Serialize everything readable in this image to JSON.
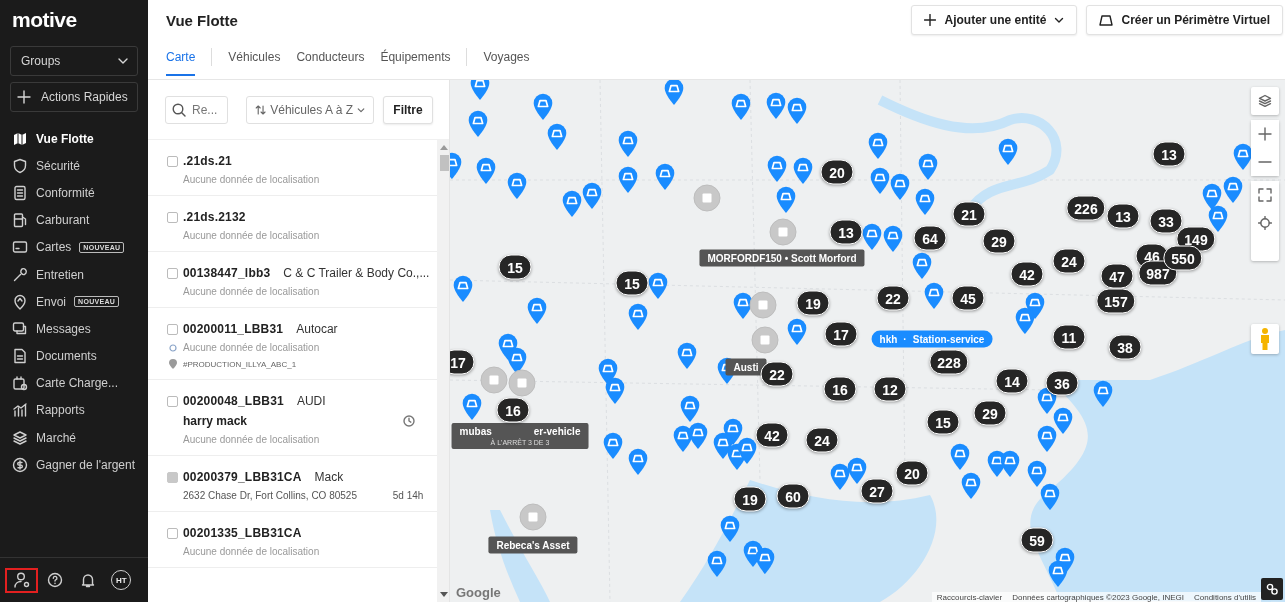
{
  "sidebar": {
    "logo": "motive",
    "groups_select": "Groups",
    "quick_action": "Actions Rapides",
    "items": [
      {
        "label": "Vue Flotte",
        "selected": true
      },
      {
        "label": "Sécurité",
        "selected": false
      },
      {
        "label": "Conformité",
        "selected": false
      },
      {
        "label": "Carburant",
        "selected": false
      },
      {
        "label": "Cartes",
        "badge": "NOUVEAU",
        "selected": false
      },
      {
        "label": "Entretien",
        "selected": false
      },
      {
        "label": "Envoi",
        "badge": "NOUVEAU",
        "selected": false
      },
      {
        "label": "Messages",
        "selected": false
      },
      {
        "label": "Documents",
        "selected": false
      },
      {
        "label": "Carte Charge...",
        "selected": false
      },
      {
        "label": "Rapports",
        "selected": false
      },
      {
        "label": "Marché",
        "selected": false
      },
      {
        "label": "Gagner de l'argent",
        "selected": false
      }
    ],
    "footer": [
      {
        "kind": "user-settings",
        "highlighted": true
      },
      {
        "kind": "help",
        "highlighted": false
      },
      {
        "kind": "bell",
        "highlighted": false
      },
      {
        "kind": "avatar",
        "label": "HT",
        "highlighted": false
      }
    ]
  },
  "header": {
    "title": "Vue Flotte",
    "buttons": [
      {
        "kind": "add",
        "label": "Ajouter une entité"
      },
      {
        "kind": "geofence",
        "label": "Créer un Périmètre Virtuel"
      }
    ],
    "tabs": [
      {
        "label": "Carte",
        "selected": true,
        "divider_after": true
      },
      {
        "label": "Véhicules",
        "selected": false,
        "divider_after": false
      },
      {
        "label": "Conducteurs",
        "selected": false,
        "divider_after": false
      },
      {
        "label": "Équipements",
        "selected": false,
        "divider_after": true
      },
      {
        "label": "Voyages",
        "selected": false,
        "divider_after": false
      }
    ]
  },
  "vehicle_list": {
    "search_placeholder": "Re...",
    "sort": "Véhicules A à Z",
    "filter": "Filtre",
    "rows": [
      {
        "name": ".21ds.21",
        "disabled": false,
        "lines": [
          {
            "kind": "muted",
            "text": "Aucune donnée de localisation"
          }
        ]
      },
      {
        "name": ".21ds.2132",
        "disabled": false,
        "lines": [
          {
            "kind": "muted",
            "text": "Aucune donnée de localisation"
          }
        ]
      },
      {
        "name": "00138447_lbb3",
        "detail": "C & C Trailer & Body Co.,...",
        "disabled": false,
        "lines": [
          {
            "kind": "muted",
            "text": "Aucune donnée de localisation"
          }
        ]
      },
      {
        "name": "00200011_LBB31",
        "detail": "Autocar",
        "disabled": false,
        "lines": [
          {
            "kind": "origin",
            "text": "Aucune donnée de localisation"
          },
          {
            "kind": "destination",
            "text": "#PRODUCTION_ILLYA_ABC_1"
          }
        ]
      },
      {
        "name": "00200048_LBB31",
        "detail": "AUDI",
        "disabled": false,
        "lines": [
          {
            "kind": "driver",
            "text": "harry mack"
          },
          {
            "kind": "muted",
            "text": "Aucune donnée de localisation"
          }
        ]
      },
      {
        "name": "00200379_LBB31CA",
        "detail": "Mack",
        "disabled": true,
        "lines": [
          {
            "kind": "address",
            "text": "2632 Chase Dr, Fort Collins, CO 80525",
            "time": "5d 14h"
          }
        ]
      },
      {
        "name": "00201335_LBB31CA",
        "disabled": false,
        "lines": [
          {
            "kind": "muted",
            "text": "Aucune donnée de localisation"
          }
        ]
      }
    ]
  },
  "map": {
    "clusters": [
      {
        "count": "13"
      },
      {
        "count": "20"
      },
      {
        "count": "21"
      },
      {
        "count": "226"
      },
      {
        "count": "13"
      },
      {
        "count": "33"
      },
      {
        "count": "13"
      },
      {
        "count": "64"
      },
      {
        "count": "29"
      },
      {
        "count": "149"
      },
      {
        "count": "15"
      },
      {
        "count": "15"
      },
      {
        "count": "42"
      },
      {
        "count": "24"
      },
      {
        "count": "47"
      },
      {
        "count": "46"
      },
      {
        "count": "987"
      },
      {
        "count": "550"
      },
      {
        "count": "19"
      },
      {
        "count": "22"
      },
      {
        "count": "45"
      },
      {
        "count": "157"
      },
      {
        "count": "17"
      },
      {
        "count": "11"
      },
      {
        "count": "38"
      },
      {
        "count": "17"
      },
      {
        "count": "228"
      },
      {
        "count": "22"
      },
      {
        "count": "16"
      },
      {
        "count": "12"
      },
      {
        "count": "14"
      },
      {
        "count": "36"
      },
      {
        "count": "16"
      },
      {
        "count": "15"
      },
      {
        "count": "29"
      },
      {
        "count": "42"
      },
      {
        "count": "24"
      },
      {
        "count": "20"
      },
      {
        "count": "19"
      },
      {
        "count": "60"
      },
      {
        "count": "27"
      },
      {
        "count": "59"
      }
    ],
    "tooltips": [
      {
        "kind": "stopped",
        "parts": [
          "MORFORDF150 • Scott Morford"
        ]
      },
      {
        "kind": "active",
        "parts": [
          "hkh",
          "·",
          "Station-service"
        ]
      },
      {
        "kind": "stopped",
        "parts": [
          "Austi"
        ]
      },
      {
        "kind": "stopped",
        "parts": [
          "mubas",
          "er-vehicle"
        ],
        "subtitle": "À L'ARRÊT 3 DE 3"
      },
      {
        "kind": "stopped",
        "parts": [
          "Rebeca's Asset"
        ]
      }
    ],
    "logo": "Google",
    "attributions": [
      "Raccourcis-clavier",
      "Données cartographiques ©2023 Google, INEGI",
      "Conditions d'utilis"
    ]
  }
}
